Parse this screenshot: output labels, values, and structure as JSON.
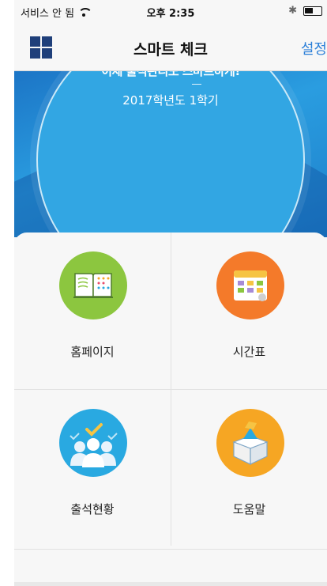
{
  "status": {
    "carrier": "서비스 안 됨",
    "time": "오후 2:35"
  },
  "nav": {
    "title": "스마트 체크",
    "settings_label": "설정"
  },
  "hero": {
    "headline": "이제 출석관리도 스마트하게!",
    "semester": "2017학년도 1학기"
  },
  "menu": {
    "items": [
      {
        "label": "홈페이지",
        "icon": "book-icon",
        "color": "#8cc63f"
      },
      {
        "label": "시간표",
        "icon": "calendar-icon",
        "color": "#f47a2a"
      },
      {
        "label": "출석현황",
        "icon": "attendance-people-icon",
        "color": "#29a9e1"
      },
      {
        "label": "도움말",
        "icon": "help-box-icon",
        "color": "#f6a623"
      }
    ]
  },
  "colors": {
    "accent": "#2b7fd8",
    "grid_icon": "#1f3f7a",
    "hero_blue": "#2a9de0"
  }
}
